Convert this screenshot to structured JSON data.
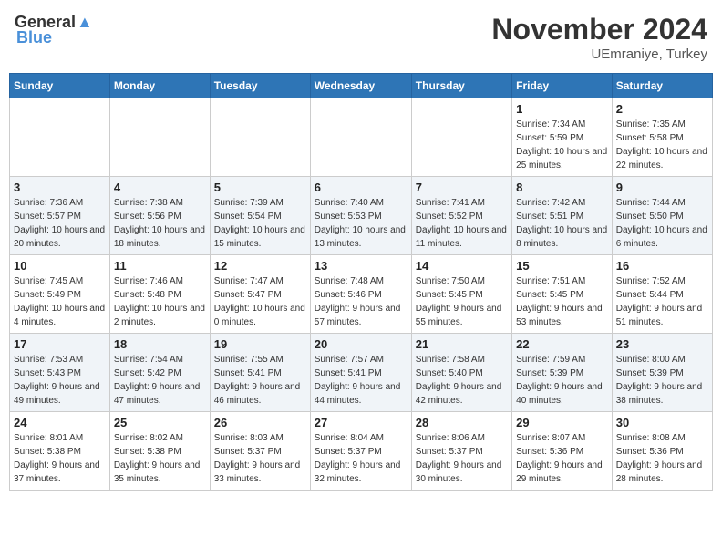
{
  "header": {
    "logo_general": "General",
    "logo_blue": "Blue",
    "month_title": "November 2024",
    "location": "UEmraniye, Turkey"
  },
  "weekdays": [
    "Sunday",
    "Monday",
    "Tuesday",
    "Wednesday",
    "Thursday",
    "Friday",
    "Saturday"
  ],
  "weeks": [
    [
      {
        "day": "",
        "sunrise": "",
        "sunset": "",
        "daylight": ""
      },
      {
        "day": "",
        "sunrise": "",
        "sunset": "",
        "daylight": ""
      },
      {
        "day": "",
        "sunrise": "",
        "sunset": "",
        "daylight": ""
      },
      {
        "day": "",
        "sunrise": "",
        "sunset": "",
        "daylight": ""
      },
      {
        "day": "",
        "sunrise": "",
        "sunset": "",
        "daylight": ""
      },
      {
        "day": "1",
        "sunrise": "Sunrise: 7:34 AM",
        "sunset": "Sunset: 5:59 PM",
        "daylight": "Daylight: 10 hours and 25 minutes."
      },
      {
        "day": "2",
        "sunrise": "Sunrise: 7:35 AM",
        "sunset": "Sunset: 5:58 PM",
        "daylight": "Daylight: 10 hours and 22 minutes."
      }
    ],
    [
      {
        "day": "3",
        "sunrise": "Sunrise: 7:36 AM",
        "sunset": "Sunset: 5:57 PM",
        "daylight": "Daylight: 10 hours and 20 minutes."
      },
      {
        "day": "4",
        "sunrise": "Sunrise: 7:38 AM",
        "sunset": "Sunset: 5:56 PM",
        "daylight": "Daylight: 10 hours and 18 minutes."
      },
      {
        "day": "5",
        "sunrise": "Sunrise: 7:39 AM",
        "sunset": "Sunset: 5:54 PM",
        "daylight": "Daylight: 10 hours and 15 minutes."
      },
      {
        "day": "6",
        "sunrise": "Sunrise: 7:40 AM",
        "sunset": "Sunset: 5:53 PM",
        "daylight": "Daylight: 10 hours and 13 minutes."
      },
      {
        "day": "7",
        "sunrise": "Sunrise: 7:41 AM",
        "sunset": "Sunset: 5:52 PM",
        "daylight": "Daylight: 10 hours and 11 minutes."
      },
      {
        "day": "8",
        "sunrise": "Sunrise: 7:42 AM",
        "sunset": "Sunset: 5:51 PM",
        "daylight": "Daylight: 10 hours and 8 minutes."
      },
      {
        "day": "9",
        "sunrise": "Sunrise: 7:44 AM",
        "sunset": "Sunset: 5:50 PM",
        "daylight": "Daylight: 10 hours and 6 minutes."
      }
    ],
    [
      {
        "day": "10",
        "sunrise": "Sunrise: 7:45 AM",
        "sunset": "Sunset: 5:49 PM",
        "daylight": "Daylight: 10 hours and 4 minutes."
      },
      {
        "day": "11",
        "sunrise": "Sunrise: 7:46 AM",
        "sunset": "Sunset: 5:48 PM",
        "daylight": "Daylight: 10 hours and 2 minutes."
      },
      {
        "day": "12",
        "sunrise": "Sunrise: 7:47 AM",
        "sunset": "Sunset: 5:47 PM",
        "daylight": "Daylight: 10 hours and 0 minutes."
      },
      {
        "day": "13",
        "sunrise": "Sunrise: 7:48 AM",
        "sunset": "Sunset: 5:46 PM",
        "daylight": "Daylight: 9 hours and 57 minutes."
      },
      {
        "day": "14",
        "sunrise": "Sunrise: 7:50 AM",
        "sunset": "Sunset: 5:45 PM",
        "daylight": "Daylight: 9 hours and 55 minutes."
      },
      {
        "day": "15",
        "sunrise": "Sunrise: 7:51 AM",
        "sunset": "Sunset: 5:45 PM",
        "daylight": "Daylight: 9 hours and 53 minutes."
      },
      {
        "day": "16",
        "sunrise": "Sunrise: 7:52 AM",
        "sunset": "Sunset: 5:44 PM",
        "daylight": "Daylight: 9 hours and 51 minutes."
      }
    ],
    [
      {
        "day": "17",
        "sunrise": "Sunrise: 7:53 AM",
        "sunset": "Sunset: 5:43 PM",
        "daylight": "Daylight: 9 hours and 49 minutes."
      },
      {
        "day": "18",
        "sunrise": "Sunrise: 7:54 AM",
        "sunset": "Sunset: 5:42 PM",
        "daylight": "Daylight: 9 hours and 47 minutes."
      },
      {
        "day": "19",
        "sunrise": "Sunrise: 7:55 AM",
        "sunset": "Sunset: 5:41 PM",
        "daylight": "Daylight: 9 hours and 46 minutes."
      },
      {
        "day": "20",
        "sunrise": "Sunrise: 7:57 AM",
        "sunset": "Sunset: 5:41 PM",
        "daylight": "Daylight: 9 hours and 44 minutes."
      },
      {
        "day": "21",
        "sunrise": "Sunrise: 7:58 AM",
        "sunset": "Sunset: 5:40 PM",
        "daylight": "Daylight: 9 hours and 42 minutes."
      },
      {
        "day": "22",
        "sunrise": "Sunrise: 7:59 AM",
        "sunset": "Sunset: 5:39 PM",
        "daylight": "Daylight: 9 hours and 40 minutes."
      },
      {
        "day": "23",
        "sunrise": "Sunrise: 8:00 AM",
        "sunset": "Sunset: 5:39 PM",
        "daylight": "Daylight: 9 hours and 38 minutes."
      }
    ],
    [
      {
        "day": "24",
        "sunrise": "Sunrise: 8:01 AM",
        "sunset": "Sunset: 5:38 PM",
        "daylight": "Daylight: 9 hours and 37 minutes."
      },
      {
        "day": "25",
        "sunrise": "Sunrise: 8:02 AM",
        "sunset": "Sunset: 5:38 PM",
        "daylight": "Daylight: 9 hours and 35 minutes."
      },
      {
        "day": "26",
        "sunrise": "Sunrise: 8:03 AM",
        "sunset": "Sunset: 5:37 PM",
        "daylight": "Daylight: 9 hours and 33 minutes."
      },
      {
        "day": "27",
        "sunrise": "Sunrise: 8:04 AM",
        "sunset": "Sunset: 5:37 PM",
        "daylight": "Daylight: 9 hours and 32 minutes."
      },
      {
        "day": "28",
        "sunrise": "Sunrise: 8:06 AM",
        "sunset": "Sunset: 5:37 PM",
        "daylight": "Daylight: 9 hours and 30 minutes."
      },
      {
        "day": "29",
        "sunrise": "Sunrise: 8:07 AM",
        "sunset": "Sunset: 5:36 PM",
        "daylight": "Daylight: 9 hours and 29 minutes."
      },
      {
        "day": "30",
        "sunrise": "Sunrise: 8:08 AM",
        "sunset": "Sunset: 5:36 PM",
        "daylight": "Daylight: 9 hours and 28 minutes."
      }
    ]
  ]
}
